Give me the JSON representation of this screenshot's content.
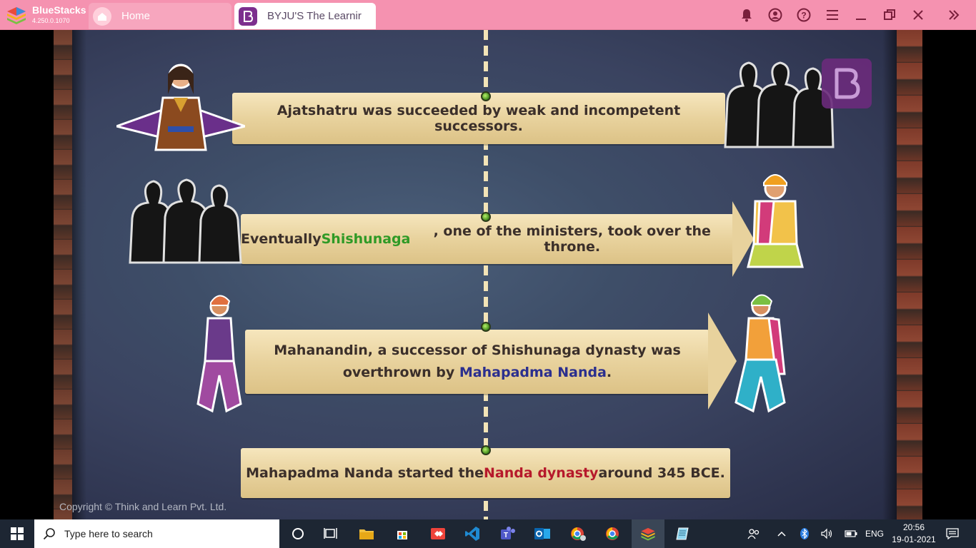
{
  "bluestacks": {
    "name": "BlueStacks",
    "version": "4.250.0.1070"
  },
  "tabs": [
    {
      "label": "Home"
    },
    {
      "label": "BYJU'S The Learnir"
    }
  ],
  "titlebar_icons": [
    "bell-icon",
    "account-icon",
    "help-icon",
    "menu-icon",
    "minimize-icon",
    "restore-icon",
    "close-icon",
    "expand-sidebar-icon"
  ],
  "lesson": {
    "banner1": "Ajatshatru was succeeded by weak and incompetent successors.",
    "banner2": {
      "before": "Eventually ",
      "highlight": "Shishunaga",
      "after": ", one of the ministers, took over the throne."
    },
    "banner3": {
      "line1": "Mahanandin, a successor of Shishunaga dynasty was",
      "line2_before": "overthrown by ",
      "line2_highlight": "Mahapadma Nanda",
      "line2_after": "."
    },
    "banner4": {
      "before": "Mahapadma Nanda started the ",
      "highlight": "Nanda dynasty",
      "after": " around 345 BCE."
    },
    "copyright": "Copyright © Think and Learn Pvt. Ltd.",
    "logo_letter": "B"
  },
  "taskbar": {
    "search_placeholder": "Type here to search",
    "language": "ENG",
    "time": "20:56",
    "date": "19-01-2021"
  },
  "colors": {
    "titlebar": "#f592b0",
    "banner_green": "#2f9a26",
    "banner_blue": "#2b2f8e",
    "banner_red": "#b6192b",
    "taskbar": "#1d2633"
  }
}
